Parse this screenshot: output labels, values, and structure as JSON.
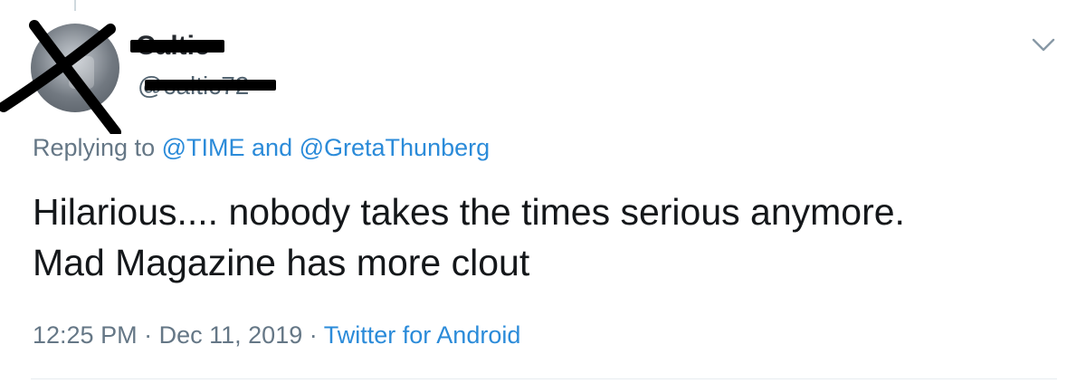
{
  "tweet": {
    "display_name": "Caltic",
    "handle": "@caltic72",
    "replying_prefix": "Replying to",
    "replying_users": [
      "@TIME",
      "@GretaThunberg"
    ],
    "replying_conjunction": "and",
    "text_lines": [
      "Hilarious.... nobody takes the times serious anymore.",
      "Mad Magazine has more clout"
    ],
    "time": "12:25 PM",
    "separator": "·",
    "date": "Dec 11, 2019",
    "source": "Twitter for Android"
  },
  "icons": {
    "menu": "chevron-down-icon",
    "avatar_overlay": "cross-out-mark"
  },
  "colors": {
    "link": "#2b8bd9",
    "muted": "#657786",
    "text": "#14171a",
    "redaction": "#000000"
  }
}
